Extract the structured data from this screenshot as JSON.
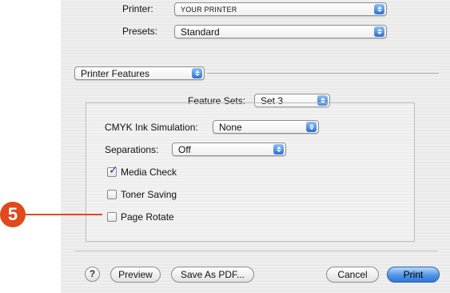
{
  "printer": {
    "label": "Printer:",
    "value": "YOUR PRINTER"
  },
  "presets": {
    "label": "Presets:",
    "value": "Standard"
  },
  "panel_menu": {
    "value": "Printer Features"
  },
  "feature_sets": {
    "label": "Feature Sets:",
    "value": "Set 3"
  },
  "cmyk": {
    "label": "CMYK Ink Simulation:",
    "value": "None"
  },
  "separations": {
    "label": "Separations:",
    "value": "Off"
  },
  "options": [
    {
      "label": "Media Check",
      "checked": true
    },
    {
      "label": "Toner Saving",
      "checked": false
    },
    {
      "label": "Page Rotate",
      "checked": false
    }
  ],
  "buttons": {
    "help": "?",
    "preview": "Preview",
    "save_pdf": "Save As PDF...",
    "cancel": "Cancel",
    "print": "Print"
  },
  "callout": {
    "number": "5",
    "color": "#e0491b"
  },
  "colors": {
    "accent": "#3a7fd8"
  }
}
